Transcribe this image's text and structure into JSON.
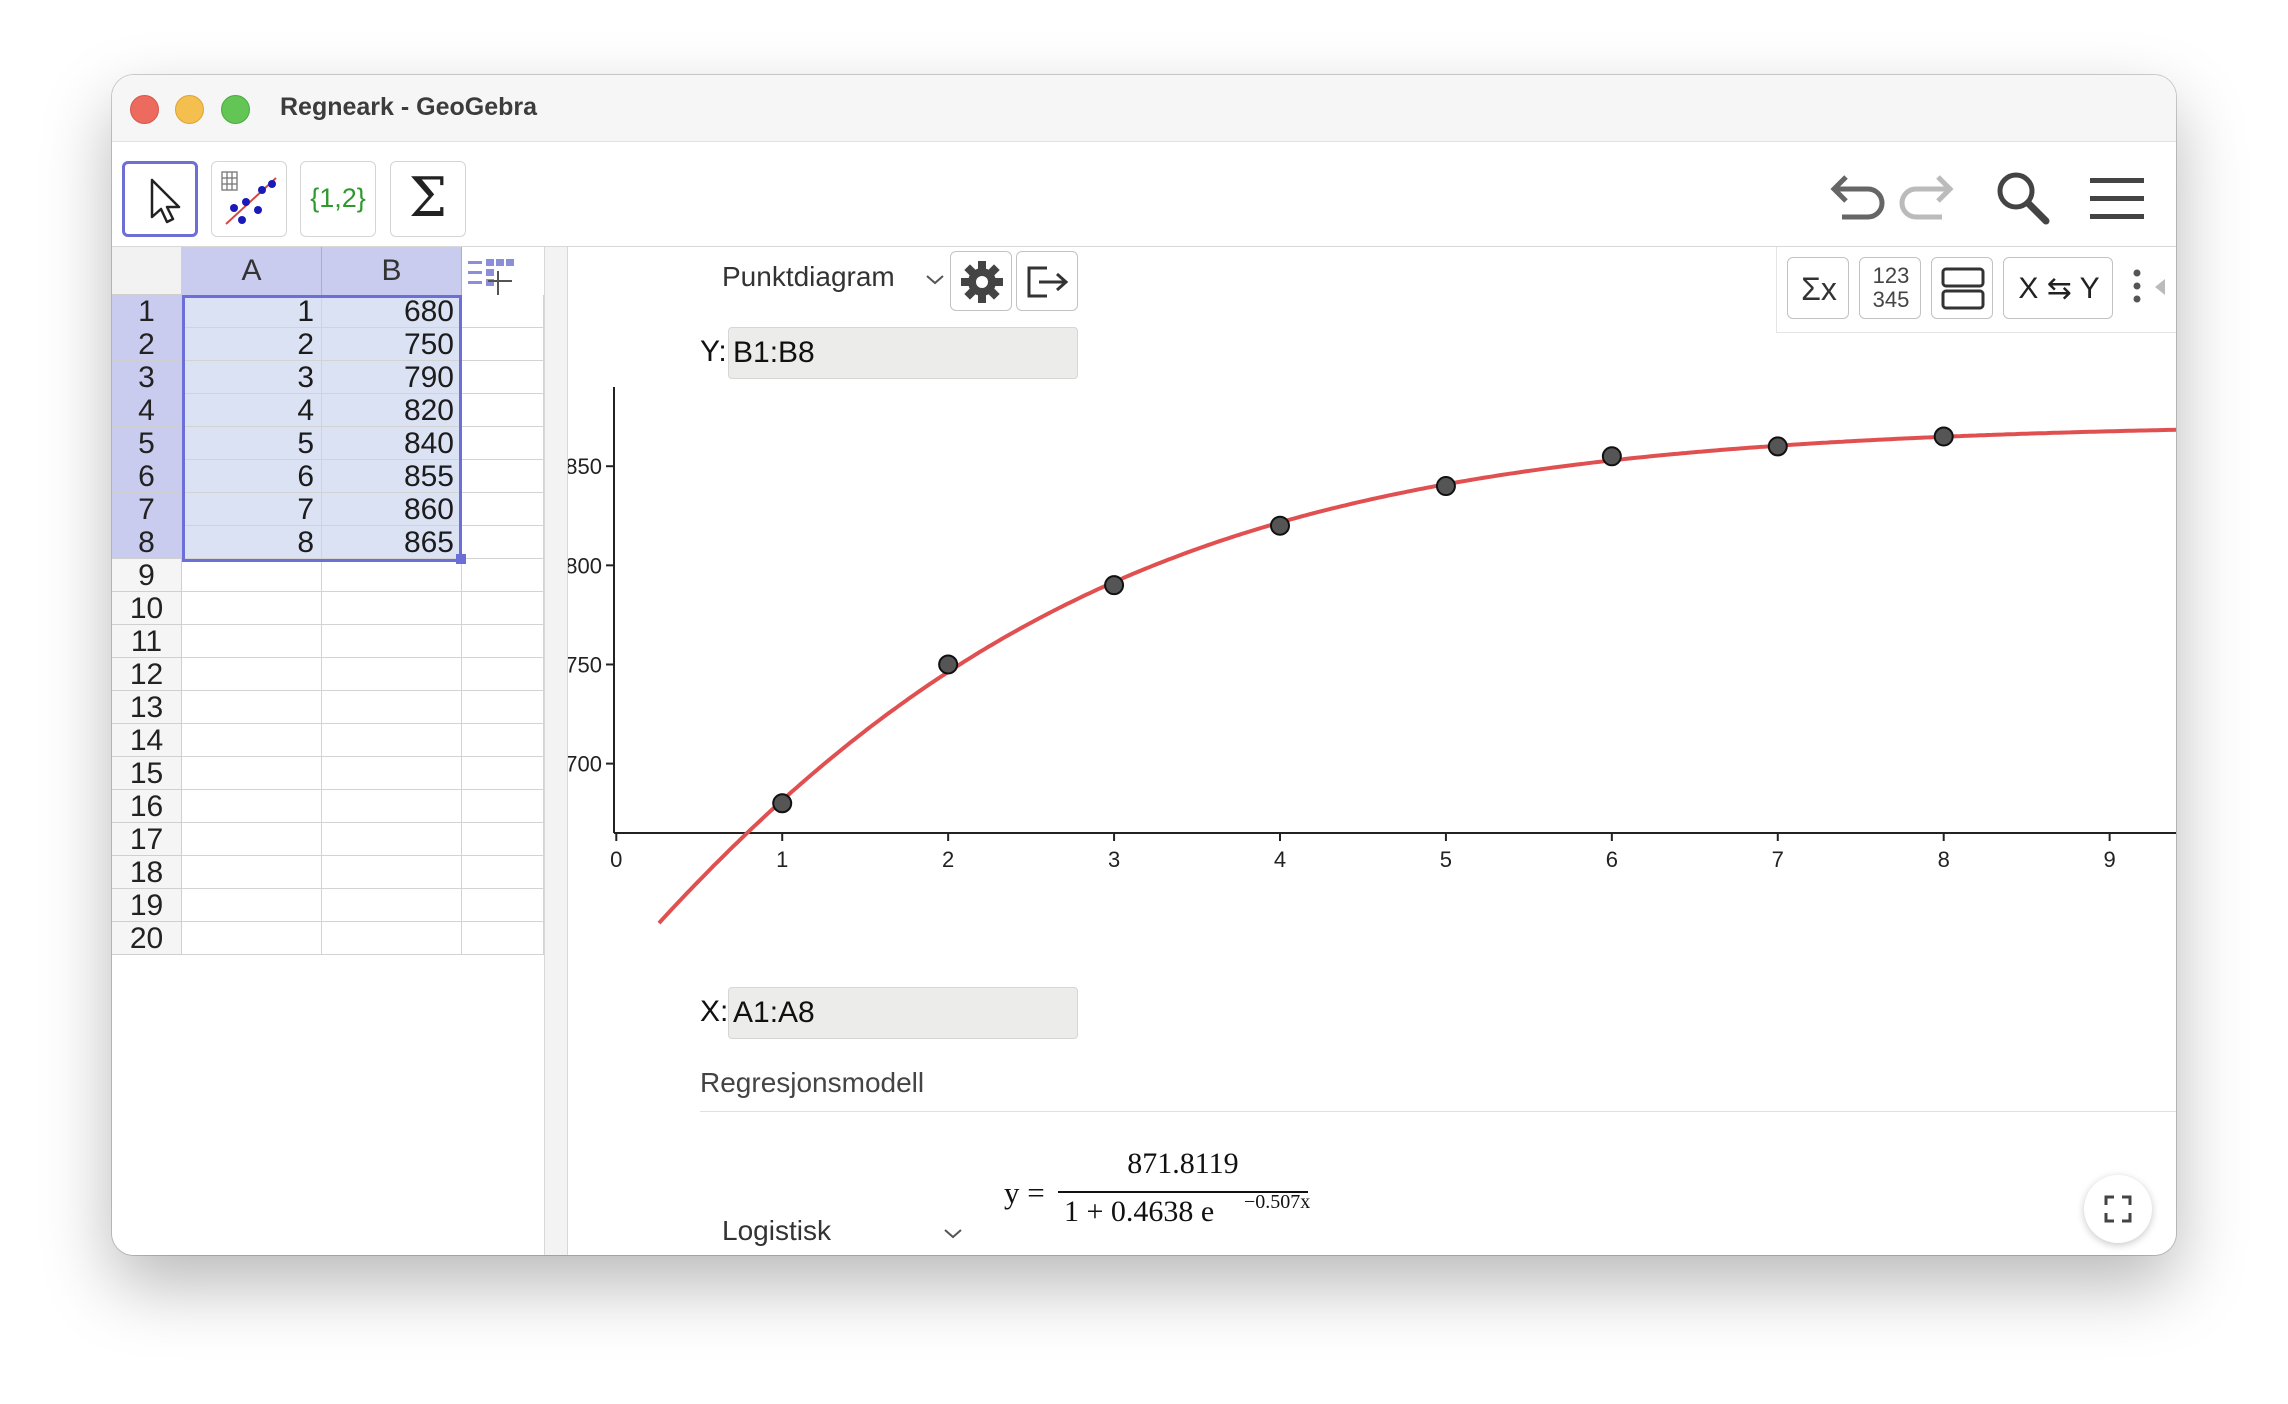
{
  "window": {
    "title": "Regneark - GeoGebra"
  },
  "toolbar": {
    "tools": [
      {
        "name": "move-tool",
        "icon": "arrow-cursor-icon"
      },
      {
        "name": "two-var-regression-tool",
        "icon": "regression-icon"
      },
      {
        "name": "list-tool",
        "icon": "list-braces-icon",
        "label": "{1,2}"
      },
      {
        "name": "sum-tool",
        "icon": "sigma-icon",
        "label": "Σ"
      }
    ],
    "right": [
      "undo-icon",
      "redo-icon",
      "search-icon",
      "menu-icon"
    ]
  },
  "spreadsheet": {
    "columns": [
      "A",
      "B"
    ],
    "rows": [
      "1",
      "2",
      "3",
      "4",
      "5",
      "6",
      "7",
      "8",
      "9",
      "10",
      "11",
      "12",
      "13",
      "14",
      "15",
      "16",
      "17",
      "18",
      "19",
      "20"
    ],
    "data": [
      [
        "1",
        "680"
      ],
      [
        "2",
        "750"
      ],
      [
        "3",
        "790"
      ],
      [
        "4",
        "820"
      ],
      [
        "5",
        "840"
      ],
      [
        "6",
        "855"
      ],
      [
        "7",
        "860"
      ],
      [
        "8",
        "865"
      ]
    ]
  },
  "panel": {
    "plot_type": "Punktdiagram",
    "y_label": "Y:",
    "y_range": "B1:B8",
    "x_label": "X:",
    "x_range": "A1:A8",
    "stat_buttons": {
      "sigma": "Σx",
      "numbers_top": "123",
      "numbers_bottom": "345",
      "swap": "X ⇆ Y"
    },
    "model_heading": "Regresjonsmodell",
    "model_type": "Logistisk",
    "formula": {
      "lhs": "y =",
      "numerator": "871.8119",
      "denominator": "1 + 0.4638 e",
      "exponent": "−0.507x"
    }
  },
  "chart_data": {
    "type": "scatter",
    "x": [
      1,
      2,
      3,
      4,
      5,
      6,
      7,
      8
    ],
    "y": [
      680,
      750,
      790,
      820,
      840,
      855,
      860,
      865
    ],
    "xlim": [
      -0.05,
      9.4
    ],
    "ylim": [
      665,
      895
    ],
    "xticks": [
      0,
      1,
      2,
      3,
      4,
      5,
      6,
      7,
      8,
      9
    ],
    "yticks": [
      700,
      750,
      800,
      850
    ],
    "grid": false,
    "model": {
      "kind": "logistic",
      "a": 871.8119,
      "b": 0.4638,
      "k": -0.507
    },
    "colors": {
      "curve": "#e05050",
      "point": "#555555",
      "point_edge": "#111111"
    }
  }
}
